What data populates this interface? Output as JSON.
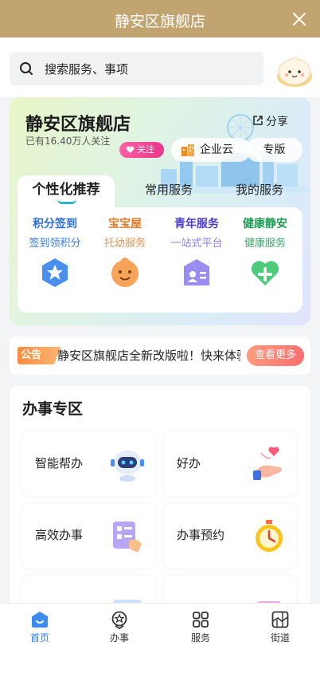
{
  "header": {
    "title": "静安区旗舰店"
  },
  "search": {
    "placeholder": "搜索服务、事项"
  },
  "store": {
    "name": "静安区旗舰店",
    "followers": "已有16.40万人关注",
    "share_label": "分享",
    "follow_label": "关注",
    "enterprise_label": "企业云",
    "edition_label": "专版"
  },
  "tabs": [
    "个性化推荐",
    "常用服务",
    "我的服务"
  ],
  "services": [
    {
      "title": "积分签到",
      "subtitle": "签到领积分",
      "title_color": "#2c6fd6",
      "subtitle_color": "#3a7ae0",
      "icon": "star-badge-icon"
    },
    {
      "title": "宝宝屋",
      "subtitle": "托幼服务",
      "title_color": "#e07c2a",
      "subtitle_color": "#e79451",
      "icon": "baby-face-icon"
    },
    {
      "title": "青年服务",
      "subtitle": "一站式平台",
      "title_color": "#4b3fc8",
      "subtitle_color": "#8a7fe0",
      "icon": "id-card-icon"
    },
    {
      "title": "健康静安",
      "subtitle": "健康服务",
      "title_color": "#1f9b55",
      "subtitle_color": "#3aa768",
      "icon": "heart-plus-icon"
    }
  ],
  "notice": {
    "tag": "公告",
    "text": "静安区旗舰店全新改版啦！快来体验吧",
    "more_label": "查看更多"
  },
  "section": {
    "title": "办事专区",
    "cards": [
      {
        "label": "智能帮办",
        "icon": "robot-icon"
      },
      {
        "label": "好办",
        "icon": "hand-heart-icon"
      },
      {
        "label": "高效办事",
        "icon": "checklist-icon"
      },
      {
        "label": "办事预约",
        "icon": "stopwatch-icon"
      }
    ]
  },
  "tabbar": [
    {
      "label": "首页",
      "icon": "home-icon",
      "active": true
    },
    {
      "label": "办事",
      "icon": "service-badge-icon",
      "active": false
    },
    {
      "label": "服务",
      "icon": "grid-icon",
      "active": false
    },
    {
      "label": "街道",
      "icon": "map-icon",
      "active": false
    }
  ]
}
